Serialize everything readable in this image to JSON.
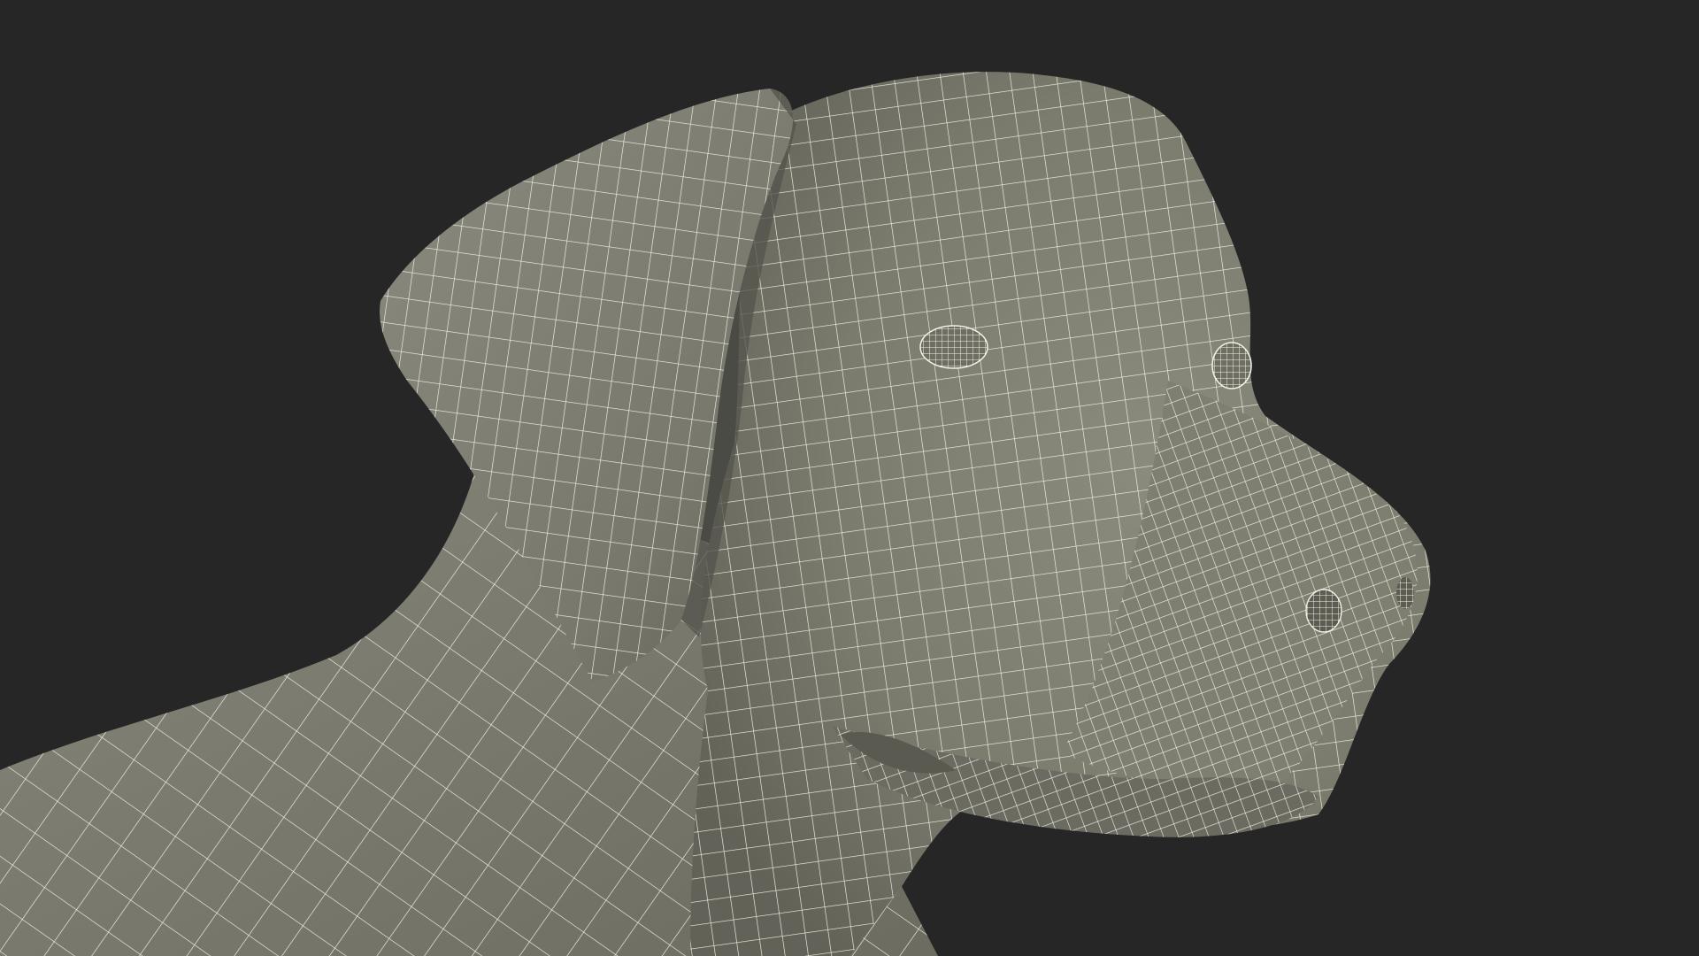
{
  "scene": {
    "subject": "wireframe-dog-head",
    "colors": {
      "background": "#262626",
      "surface": "#7b7b6e",
      "surface_shadow": "#5f5f55",
      "surface_light": "#8a8a7d",
      "wire": "#f4f2e6"
    }
  }
}
